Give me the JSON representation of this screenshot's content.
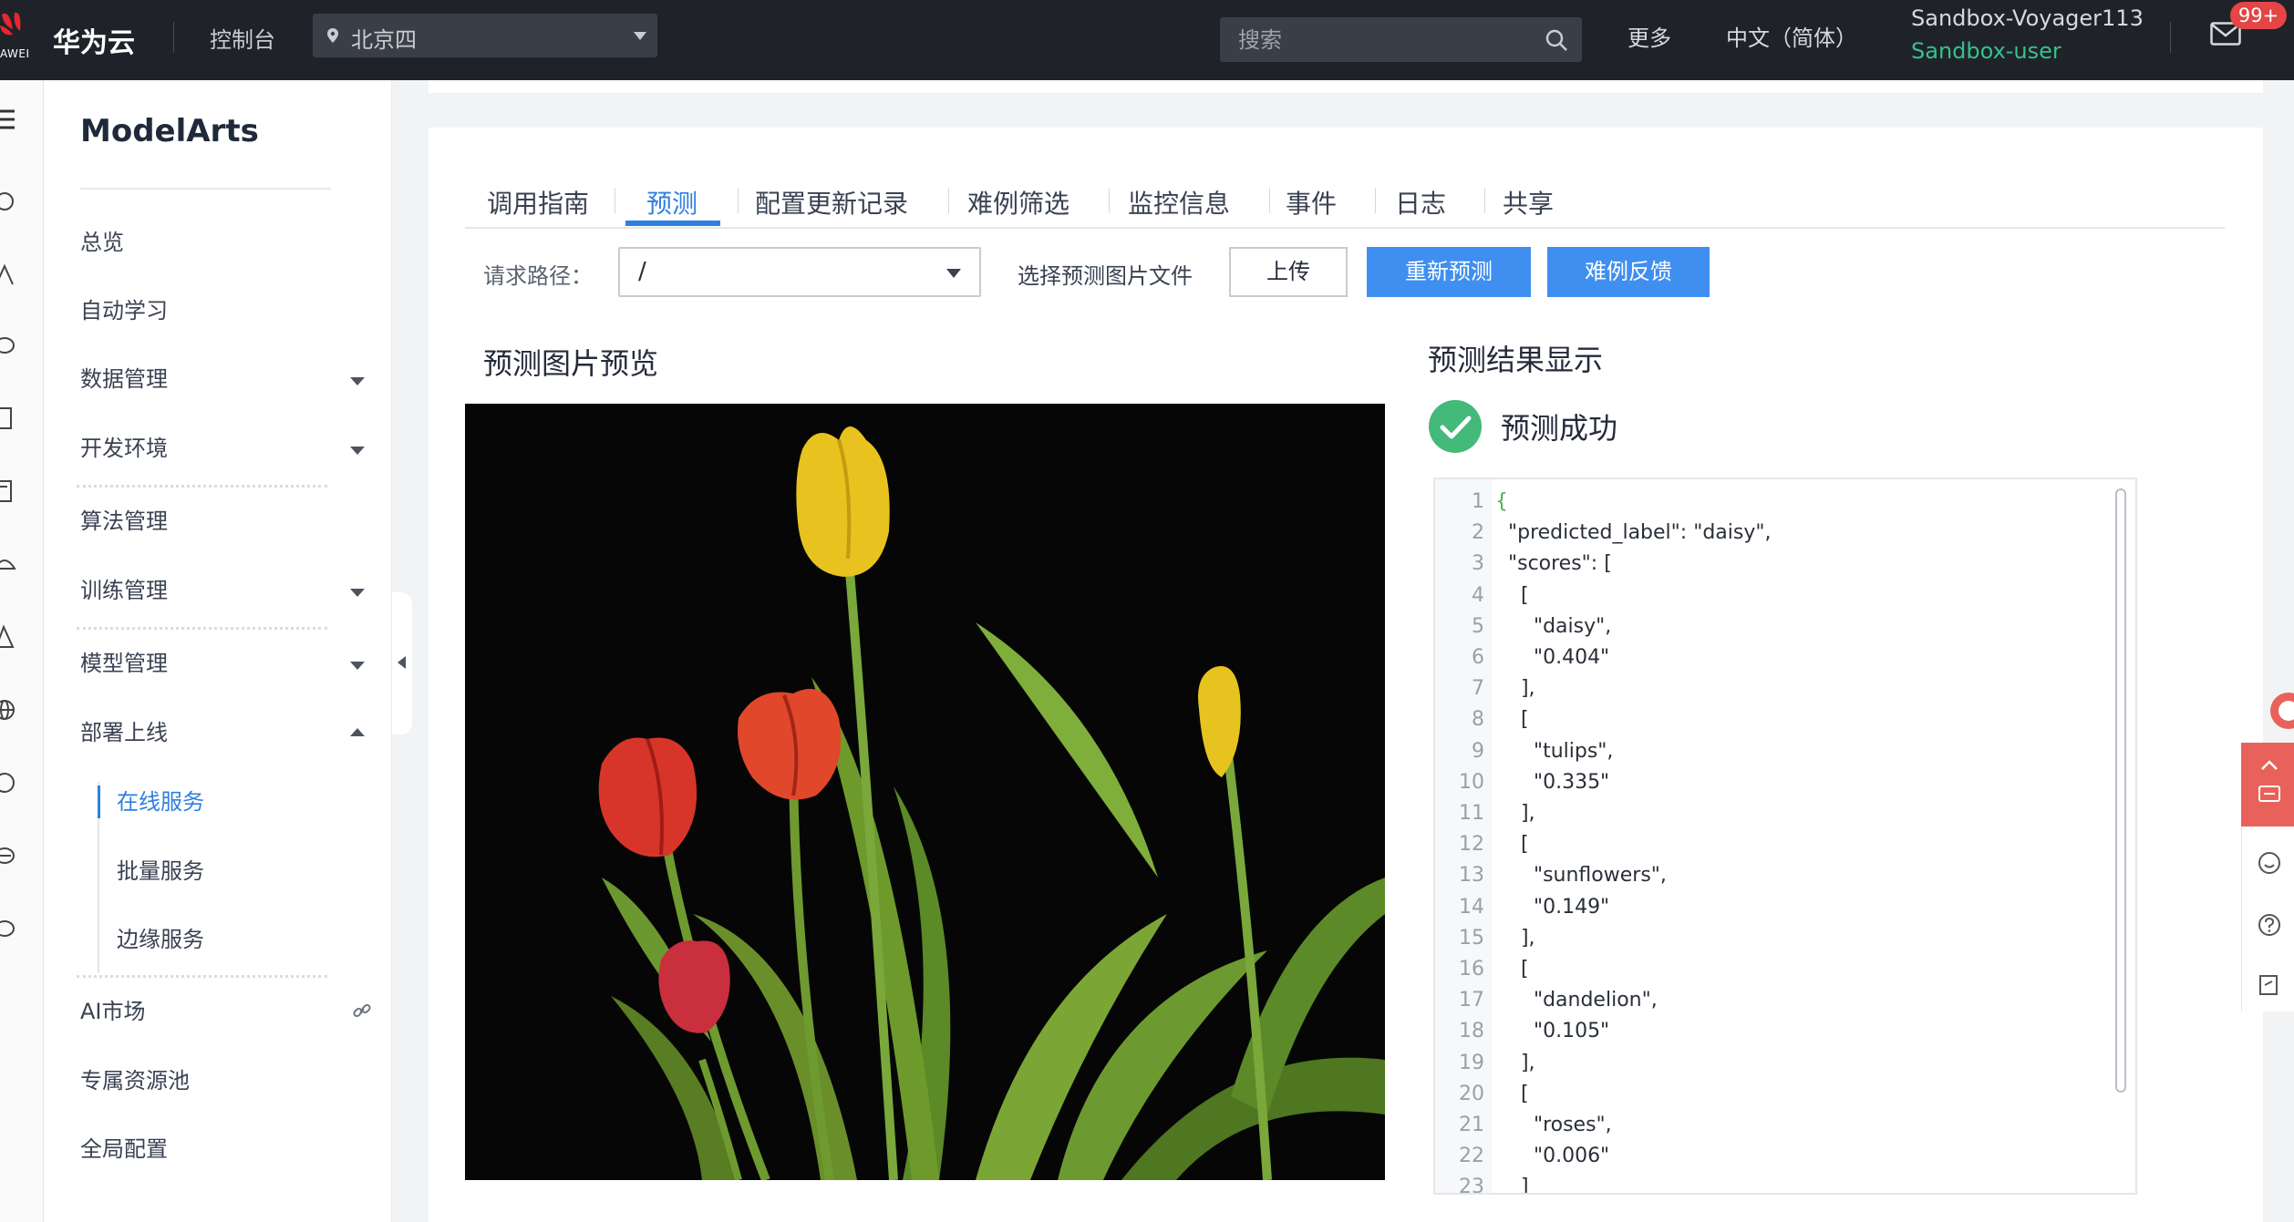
{
  "topbar": {
    "logo_text": "AWEI",
    "brand": "华为云",
    "console": "控制台",
    "region": "北京四",
    "search_placeholder": "搜索",
    "more": "更多",
    "language": "中文（简体）",
    "account_name": "Sandbox-Voyager113",
    "account_user": "Sandbox-user",
    "mail_badge": "99+"
  },
  "sidebar": {
    "title": "ModelArts",
    "items": [
      {
        "label": "总览"
      },
      {
        "label": "自动学习"
      },
      {
        "label": "数据管理"
      },
      {
        "label": "开发环境"
      },
      {
        "label": "算法管理"
      },
      {
        "label": "训练管理"
      },
      {
        "label": "模型管理"
      },
      {
        "label": "部署上线"
      },
      {
        "label": "AI市场"
      },
      {
        "label": "专属资源池"
      },
      {
        "label": "全局配置"
      }
    ],
    "sub_items": [
      {
        "label": "在线服务"
      },
      {
        "label": "批量服务"
      },
      {
        "label": "边缘服务"
      }
    ]
  },
  "tabs": [
    "调用指南",
    "预测",
    "配置更新记录",
    "难例筛选",
    "监控信息",
    "事件",
    "日志",
    "共享"
  ],
  "toolbar": {
    "request_path_label": "请求路径：",
    "request_path_value": "/",
    "choose_file_label": "选择预测图片文件",
    "upload_label": "上传",
    "repredict_label": "重新预测",
    "feedback_label": "难例反馈"
  },
  "preview": {
    "heading": "预测图片预览"
  },
  "result": {
    "heading": "预测结果显示",
    "status": "预测成功",
    "lines": [
      "{",
      "  \"predicted_label\": \"daisy\",",
      "  \"scores\": [",
      "    [",
      "      \"daisy\",",
      "      \"0.404\"",
      "    ],",
      "    [",
      "      \"tulips\",",
      "      \"0.335\"",
      "    ],",
      "    [",
      "      \"sunflowers\",",
      "      \"0.149\"",
      "    ],",
      "    [",
      "      \"dandelion\",",
      "      \"0.105\"",
      "    ],",
      "    [",
      "      \"roses\",",
      "      \"0.006\"",
      "    ]"
    ],
    "line_numbers": [
      "1",
      "2",
      "3",
      "4",
      "5",
      "6",
      "7",
      "8",
      "9",
      "10",
      "11",
      "12",
      "13",
      "14",
      "15",
      "16",
      "17",
      "18",
      "19",
      "20",
      "21",
      "22",
      "23"
    ]
  },
  "colors": {
    "accent": "#2f7fe0",
    "primary_button": "#3f8ff0",
    "success": "#43b97a",
    "topbar": "#1f2329",
    "user_green": "#36c18b",
    "badge_red": "#e54545"
  },
  "icons": {
    "search": "search-icon",
    "region": "location-pin-icon",
    "mail": "mail-icon",
    "success": "check-circle-icon",
    "collapse": "chevron-left-icon",
    "link": "link-icon"
  }
}
